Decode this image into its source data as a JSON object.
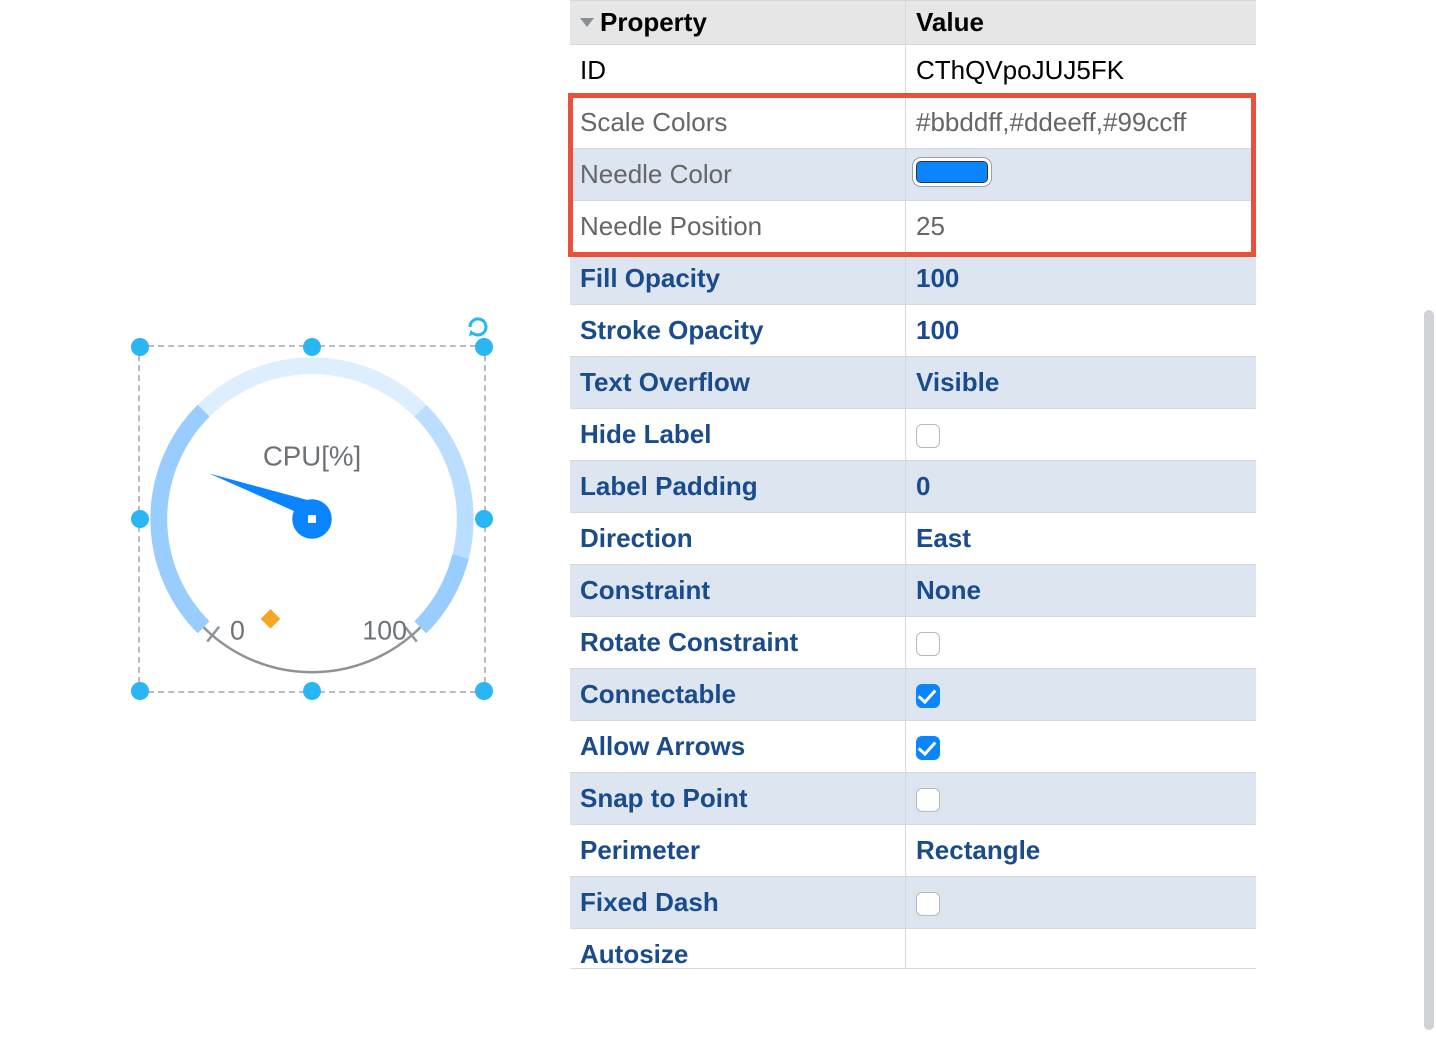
{
  "panel": {
    "header_property": "Property",
    "header_value": "Value",
    "rows": [
      {
        "key": "id",
        "label": "ID",
        "value": "CThQVpoJUJ5FK",
        "blue": false,
        "shaded": false,
        "type": "text"
      },
      {
        "key": "scale_colors",
        "label": "Scale Colors",
        "value": "#bbddff,#ddeeff,#99ccff",
        "blue": false,
        "shaded": false,
        "type": "text",
        "muted": true
      },
      {
        "key": "needle_color",
        "label": "Needle Color",
        "value": "#0a84ff",
        "blue": false,
        "shaded": true,
        "type": "swatch",
        "muted": true
      },
      {
        "key": "needle_position",
        "label": "Needle Position",
        "value": "25",
        "blue": false,
        "shaded": false,
        "type": "text",
        "muted": true
      },
      {
        "key": "fill_opacity",
        "label": "Fill Opacity",
        "value": "100",
        "blue": true,
        "shaded": true,
        "type": "text"
      },
      {
        "key": "stroke_opacity",
        "label": "Stroke Opacity",
        "value": "100",
        "blue": true,
        "shaded": false,
        "type": "text"
      },
      {
        "key": "text_overflow",
        "label": "Text Overflow",
        "value": "Visible",
        "blue": true,
        "shaded": true,
        "type": "text"
      },
      {
        "key": "hide_label",
        "label": "Hide Label",
        "value": false,
        "blue": true,
        "shaded": false,
        "type": "checkbox"
      },
      {
        "key": "label_padding",
        "label": "Label Padding",
        "value": "0",
        "blue": true,
        "shaded": true,
        "type": "text"
      },
      {
        "key": "direction",
        "label": "Direction",
        "value": "East",
        "blue": true,
        "shaded": false,
        "type": "text"
      },
      {
        "key": "constraint",
        "label": "Constraint",
        "value": "None",
        "blue": true,
        "shaded": true,
        "type": "text"
      },
      {
        "key": "rotate_constraint",
        "label": "Rotate Constraint",
        "value": false,
        "blue": true,
        "shaded": false,
        "type": "checkbox"
      },
      {
        "key": "connectable",
        "label": "Connectable",
        "value": true,
        "blue": true,
        "shaded": true,
        "type": "checkbox"
      },
      {
        "key": "allow_arrows",
        "label": "Allow Arrows",
        "value": true,
        "blue": true,
        "shaded": false,
        "type": "checkbox"
      },
      {
        "key": "snap_to_point",
        "label": "Snap to Point",
        "value": false,
        "blue": true,
        "shaded": true,
        "type": "checkbox"
      },
      {
        "key": "perimeter",
        "label": "Perimeter",
        "value": "Rectangle",
        "blue": true,
        "shaded": false,
        "type": "text"
      },
      {
        "key": "fixed_dash",
        "label": "Fixed Dash",
        "value": false,
        "blue": true,
        "shaded": true,
        "type": "checkbox"
      },
      {
        "key": "autosize",
        "label": "Autosize",
        "value": "",
        "blue": true,
        "shaded": false,
        "type": "text",
        "cut": true
      }
    ]
  },
  "gauge": {
    "label": "CPU[%]",
    "min": "0",
    "max": "100",
    "needle_value": 25,
    "scale_colors": [
      "#bbddff",
      "#ddeeff",
      "#99ccff"
    ],
    "needle_color": "#0a84ff"
  },
  "highlight": {
    "top_row_index": 1,
    "bottom_row_index": 3
  },
  "colors": {
    "accent": "#0a84ff",
    "handle": "#29b6f2",
    "highlight": "#e8513a"
  }
}
